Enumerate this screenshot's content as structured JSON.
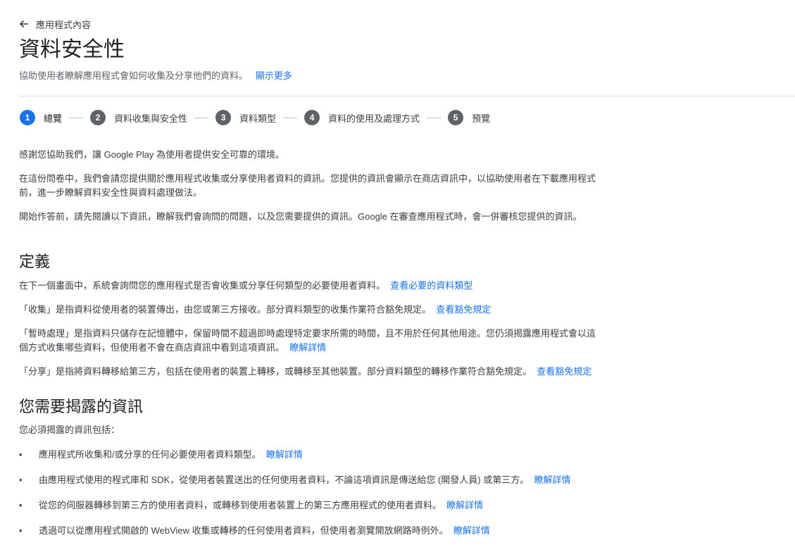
{
  "nav": {
    "back_label": "應用程式內容"
  },
  "header": {
    "title": "資料安全性",
    "subtitle": "協助使用者瞭解應用程式會如何收集及分享他們的資料。",
    "show_more": "顯示更多"
  },
  "steps": [
    {
      "number": "1",
      "label": "總覽"
    },
    {
      "number": "2",
      "label": "資料收集與安全性"
    },
    {
      "number": "3",
      "label": "資料類型"
    },
    {
      "number": "4",
      "label": "資料的使用及處理方式"
    },
    {
      "number": "5",
      "label": "預覽"
    }
  ],
  "intro": {
    "p1": "感謝您協助我們，讓 Google Play 為使用者提供安全可靠的環境。",
    "p2_line1": "在這份問卷中，我們會請您提供關於應用程式收集或分享使用者資料的資訊。您提供的資訊會顯示在商店資訊中，以協助使用者在下載應用程式",
    "p2_line2": "前，進一步瞭解資料安全性與資料處理做法。",
    "p3": "開始作答前，請先閱讀以下資訊，瞭解我們會詢問的問題，以及您需要提供的資訊。Google 在審查應用程式時，會一併審核您提供的資訊。"
  },
  "definitions": {
    "heading": "定義",
    "d1_text": "在下一個畫面中，系統會詢問您的應用程式是否會收集或分享任何類型的必要使用者資料。",
    "d1_link": "查看必要的資料類型",
    "d2_text": "「收集」是指資料從使用者的裝置傳出，由您或第三方接收。部分資料類型的收集作業符合豁免規定。",
    "d2_link": "查看豁免規定",
    "d3_line1": "「暫時處理」是指資料只儲存在記憶體中，保留時間不超過即時處理特定要求所需的時間，且不用於任何其他用途。您仍須揭露應用程式會以這",
    "d3_line2": "個方式收集哪些資料，但使用者不會在商店資訊中看到這項資訊。",
    "d3_link": "瞭解詳情",
    "d4_text": "「分享」是指將資料轉移給第三方，包括在使用者的裝置上轉移，或轉移至其他裝置。部分資料類型的轉移作業符合豁免規定。",
    "d4_link": "查看豁免規定"
  },
  "disclosure": {
    "heading": "您需要揭露的資訊",
    "intro": "您必須揭露的資訊包括：",
    "items": [
      {
        "text": "應用程式所收集和/或分享的任何必要使用者資料類型。",
        "link": "瞭解詳情"
      },
      {
        "text": "由應用程式使用的程式庫和 SDK，從使用者裝置送出的任何使用者資料，不論這項資訊是傳送給您 (開發人員) 或第三方。",
        "link": "瞭解詳情"
      },
      {
        "text": "從您的伺服器轉移到第三方的使用者資料，或轉移到使用者裝置上的第三方應用程式的使用者資料。",
        "link": "瞭解詳情"
      },
      {
        "text": "透過可以從應用程式開啟的 WebView 收集或轉移的任何使用者資料，但使用者瀏覽開放網路時例外。",
        "link": "瞭解詳情"
      }
    ],
    "bullet": "•"
  },
  "colors": {
    "accent": "#1a73e8",
    "step_inactive": "#5f6368",
    "text": "#3c4043",
    "divider": "#dadce0"
  },
  "icons": {
    "back": "arrow-left-icon"
  }
}
